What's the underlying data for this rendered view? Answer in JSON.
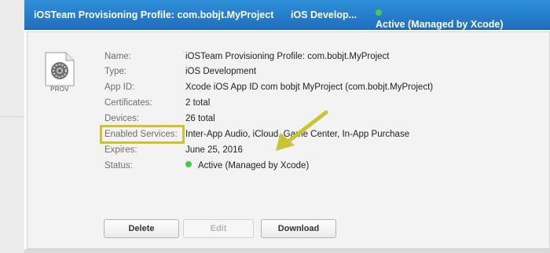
{
  "header": {
    "profile_name": "iOSTeam Provisioning Profile: com.bobjt.MyProject",
    "profile_type": "iOS Develop...",
    "status": "Active (Managed by Xcode)"
  },
  "file_icon": {
    "caption": "PROV"
  },
  "details": [
    {
      "label": "Name:",
      "value": "iOSTeam Provisioning Profile: com.bobjt.MyProject"
    },
    {
      "label": "Type:",
      "value": "iOS Development"
    },
    {
      "label": "App ID:",
      "value": "Xcode iOS App ID com bobjt MyProject (com.bobjt.MyProject)"
    },
    {
      "label": "Certificates:",
      "value": "2 total"
    },
    {
      "label": "Devices:",
      "value": "26 total"
    },
    {
      "label": "Enabled Services:",
      "value": "Inter-App Audio, iCloud, Game Center, In-App Purchase"
    },
    {
      "label": "Expires:",
      "value": "June 25, 2016"
    },
    {
      "label": "Status:",
      "value": "Active (Managed by Xcode)"
    }
  ],
  "buttons": {
    "delete": "Delete",
    "edit": "Edit",
    "download": "Download"
  },
  "colors": {
    "header_blue": "#2a83d0",
    "status_green": "#4cc84a",
    "highlight_yellow": "#c9c42f"
  }
}
